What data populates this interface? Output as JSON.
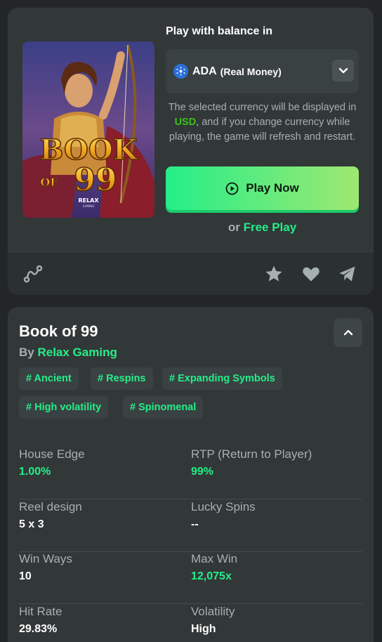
{
  "play": {
    "title": "Play with balance in",
    "currency_code": "ADA",
    "currency_type": "(Real Money)",
    "notice_pre": "The selected currency will be displayed in ",
    "notice_currency": "USD",
    "notice_post": ", and if you change currency while playing, the game will refresh and restart.",
    "play_now_label": "Play Now",
    "or_label": "or",
    "free_play_label": "Free Play"
  },
  "cover": {
    "title_line1": "BOOK",
    "title_of": "OF",
    "title_number": "99",
    "brand": "RELAX",
    "brand_sub": "GAMING"
  },
  "toolbar": {
    "icons": [
      "share-path-icon",
      "star-icon",
      "heart-icon",
      "telegram-icon"
    ]
  },
  "details": {
    "game_title": "Book of 99",
    "by_label": "By",
    "provider": "Relax Gaming",
    "tags": [
      "# Ancient",
      "# Respins",
      "# Expanding Symbols",
      "# High volatility",
      "# Spinomenal"
    ],
    "stats": [
      {
        "label": "House Edge",
        "value": "1.00%"
      },
      {
        "label": "RTP (Return to Player)",
        "value": "99%"
      },
      {
        "label": "Reel design",
        "value": "5 x 3"
      },
      {
        "label": "Lucky Spins",
        "value": "--"
      },
      {
        "label": "Win Ways",
        "value": "10"
      },
      {
        "label": "Max Win",
        "value": "12,075x"
      },
      {
        "label": "Hit Rate",
        "value": "29.83%"
      },
      {
        "label": "Volatility",
        "value": "High"
      }
    ]
  },
  "colors": {
    "accent": "#24ee89",
    "panel": "#323738",
    "background": "#232626",
    "muted_text": "#a7b0b1"
  }
}
